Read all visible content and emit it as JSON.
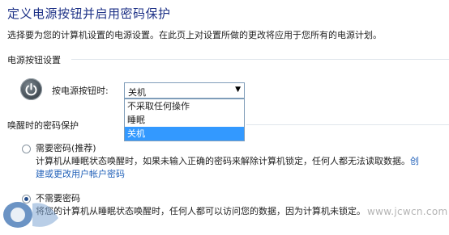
{
  "page": {
    "title": "定义电源按钮并启用密码保护",
    "description": "选择要为您的计算机设置的电源设置。在此页上对设置所做的更改将应用于您所有的电源计划。"
  },
  "power_section": {
    "heading": "电源按钮设置",
    "label": "按电源按钮时:",
    "selected": "关机",
    "options": [
      "不采取任何操作",
      "睡眠",
      "关机"
    ]
  },
  "password_section": {
    "heading": "唤醒时的密码保护",
    "option_require": {
      "label": "需要密码(推荐)",
      "note_line1": "计算机从睡眠状态唤醒时，如果未输入正确的密码来解除计算机锁定，任何人都无法读取数据。",
      "link_part1": "创",
      "link_part2": "建或更改用户帐户密码"
    },
    "option_none": {
      "label": "不需要密码",
      "note": "将您的计算机从睡眠状态唤醒时，任何人都可以访问您的数据，因为计算机未锁定。"
    }
  },
  "watermark": {
    "right": "www.jcwcn.com"
  },
  "colors": {
    "title": "#1e3287",
    "link": "#1f5fb8",
    "selection": "#3399ff"
  }
}
